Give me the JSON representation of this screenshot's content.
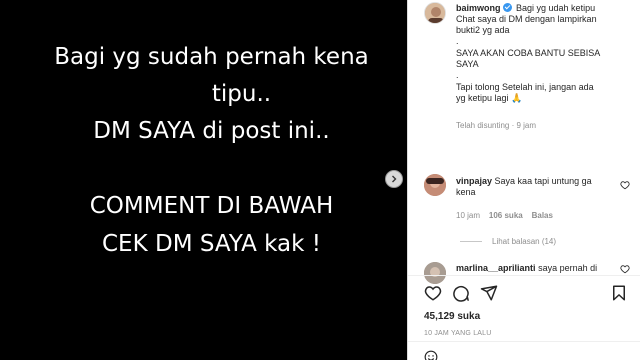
{
  "post": {
    "lines": [
      "Bagi yg sudah pernah kena",
      "tipu..",
      "DM SAYA di post ini..",
      "COMMENT DI BAWAH",
      "CEK DM SAYA kak !"
    ]
  },
  "caption": {
    "username": "baimwong",
    "text_first": "Bagi yg udah ketipu",
    "line2": "Chat saya di DM dengan lampirkan",
    "line3": "bukti2 yg ada",
    "line4": ".",
    "line5": "SAYA AKAN COBA BANTU SEBISA",
    "line6": "SAYA",
    "line7": ".",
    "line8": "Tapi tolong Setelah ini, jangan ada",
    "line9": "yg ketipu lagi 🙏",
    "edited": "Telah disunting · 9 jam"
  },
  "comments": [
    {
      "username": "vinpajay",
      "text": "Saya kaa tapi untung ga",
      "text2": "kena",
      "time": "10 jam",
      "likes": "106 suka",
      "reply": "Balas",
      "view_replies": "Lihat balasan (14)"
    },
    {
      "username": "marlina__aprilianti",
      "text": "saya pernah di"
    }
  ],
  "footer": {
    "likes": "45,129 suka",
    "time_ago": "10 JAM YANG LALU"
  },
  "icons": {
    "verified": "verified-badge-icon",
    "like": "heart-icon",
    "comment": "comment-icon",
    "share": "share-icon",
    "save": "bookmark-icon",
    "next": "chevron-right-icon",
    "emoji": "emoji-icon"
  },
  "colors": {
    "verified": "#3897f0",
    "image_bg": "#000000"
  }
}
